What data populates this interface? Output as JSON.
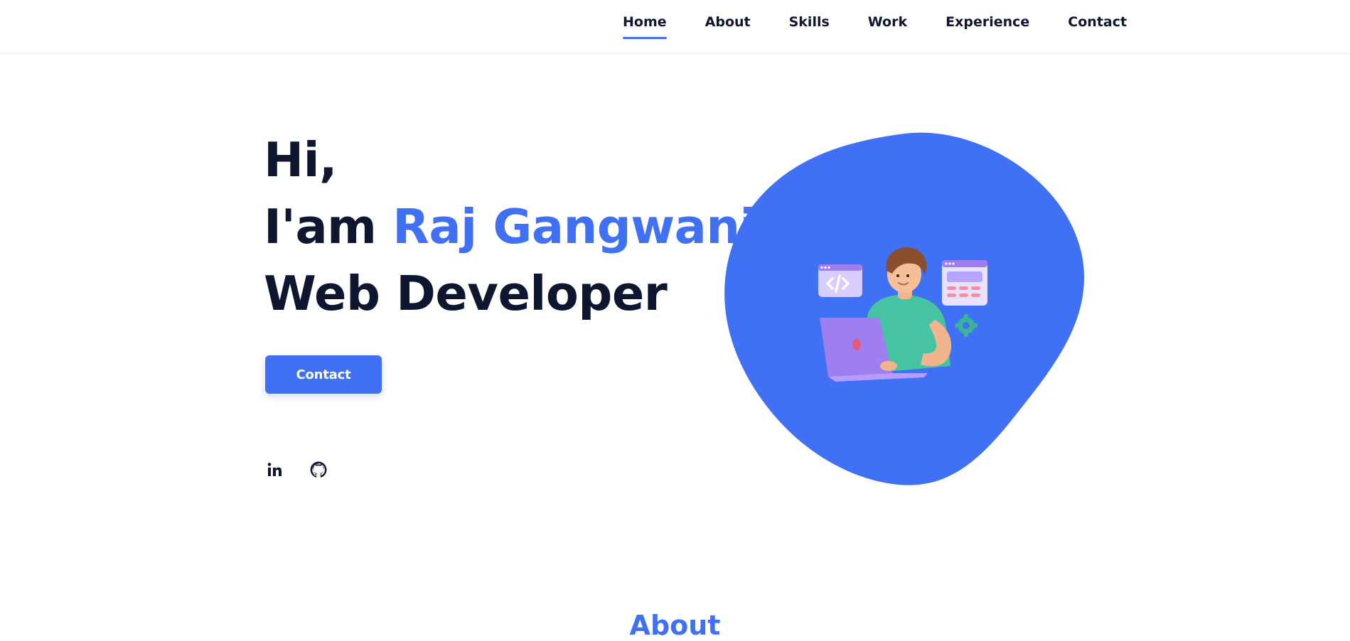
{
  "nav": {
    "items": [
      {
        "label": "Home",
        "active": true
      },
      {
        "label": "About",
        "active": false
      },
      {
        "label": "Skills",
        "active": false
      },
      {
        "label": "Work",
        "active": false
      },
      {
        "label": "Experience",
        "active": false
      },
      {
        "label": "Contact",
        "active": false
      }
    ]
  },
  "hero": {
    "line1": "Hi,",
    "line2_prefix": "I'am ",
    "line2_name": "Raj Gangwani",
    "line3": "Web Developer",
    "button_label": "Contact",
    "illustration": "developer-at-laptop-illustration",
    "social": [
      {
        "icon": "linkedin-icon"
      },
      {
        "icon": "github-icon"
      }
    ]
  },
  "about": {
    "title": "About"
  },
  "colors": {
    "accent": "#4070f4",
    "text": "#0e1630",
    "background": "#ffffff"
  }
}
